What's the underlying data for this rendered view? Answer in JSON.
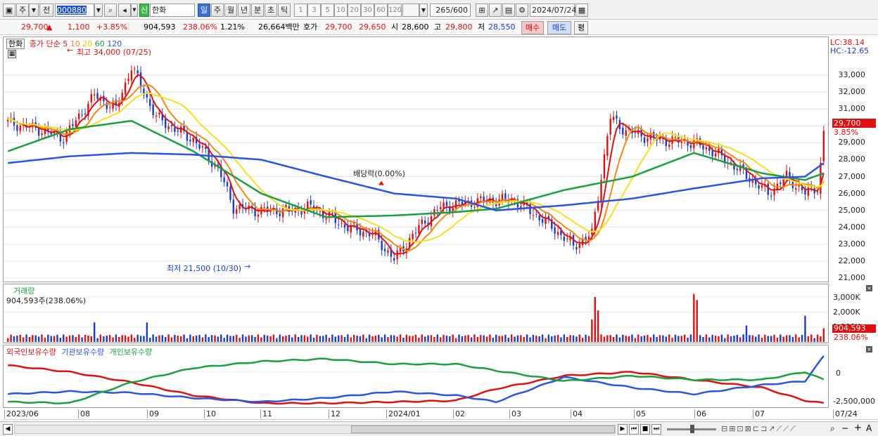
{
  "toolbar": {
    "type_label": "주",
    "jeon_label": "전",
    "code_value": "000880",
    "sin_label": "신",
    "stock_name": "한화",
    "periods": [
      "일",
      "주",
      "월",
      "년",
      "분",
      "초",
      "틱"
    ],
    "numbers": [
      "1",
      "3",
      "5",
      "10",
      "20",
      "30",
      "60",
      "120"
    ],
    "count": "265",
    "count_total": "/600",
    "date": "2024/07/24"
  },
  "price": {
    "current": "29,700",
    "arrow": "▲",
    "change": "1,100",
    "change_pct": "+3.85%",
    "volume": "904,593",
    "volume_ratio": "238.06%",
    "turnover": "1.21%",
    "amount": "26,664백만",
    "hoga_label": "호가",
    "ask": "29,700",
    "bid": "29,650",
    "open_label": "시",
    "open": "28,600",
    "high_label": "고",
    "high": "29,800",
    "low_label": "저",
    "low": "28,550",
    "buy_label": "매수",
    "sell_label": "매도",
    "eval_label": "평"
  },
  "legend": {
    "stock": "한화",
    "ma_title": "종가 단순",
    "ma_periods": [
      "5",
      "10",
      "20",
      "60",
      "120"
    ]
  },
  "annotations": {
    "high": "최고 34,000 (07/25)",
    "low": "최저 21,500 (10/30)",
    "dividend": "배당락(0.00%)",
    "lc": "LC:38.14",
    "hc": "HC:-12.65",
    "last_price": "29,700",
    "last_pct": "3.85%",
    "last_volume": "904,593",
    "last_volume_pct": "238.06%"
  },
  "volume_pane": {
    "title": "거래량",
    "value": "904,593주(238.06%)"
  },
  "holdings_pane": {
    "series_labels": [
      "외국인보유수량",
      "기관보유수량",
      "개인보유수량"
    ]
  },
  "price_ticks": [
    "33,000",
    "32,000",
    "31,000",
    "30,000",
    "29,000",
    "28,000",
    "27,000",
    "26,000",
    "25,000",
    "24,000",
    "23,000",
    "22,000",
    "21,000"
  ],
  "volume_ticks": [
    "3,000K",
    "2,000K",
    "1,000K"
  ],
  "holdings_ticks": [
    "0",
    "-2,500,000"
  ],
  "date_ticks": [
    "2023/06",
    "08",
    "09",
    "10",
    "11",
    "12",
    "2024/01",
    "02",
    "03",
    "04",
    "05",
    "06",
    "07",
    "07/24"
  ],
  "colors": {
    "up": "#e01010",
    "down": "#1a3ccc",
    "ma5": "#e01010",
    "ma10": "#f08a10",
    "ma20": "#f5e020",
    "ma60": "#1aa040",
    "ma120": "#2a55e0",
    "foreign": "#e01010",
    "institution": "#2a55e0",
    "individual": "#1aa040"
  },
  "chart_data": {
    "type": "line",
    "x": [
      "2023/06",
      "07",
      "08",
      "09",
      "10",
      "11",
      "12",
      "2024/01",
      "02",
      "03",
      "04",
      "05",
      "06",
      "07",
      "07/24"
    ],
    "series": [
      {
        "name": "종가",
        "values": [
          30000,
          31000,
          29000,
          25000,
          24000,
          22000,
          25500,
          25500,
          23000,
          30000,
          29000,
          26500,
          26500,
          27500,
          29700
        ]
      },
      {
        "name": "120",
        "values": [
          27800,
          28200,
          28400,
          28300,
          28000,
          27000,
          26000,
          25700,
          25000,
          25300,
          25700,
          26300,
          26900,
          27000,
          27800
        ]
      },
      {
        "name": "60",
        "values": [
          28500,
          29800,
          30300,
          28500,
          26000,
          24600,
          24700,
          24900,
          25100,
          26200,
          27000,
          28400,
          27200,
          26800,
          27200
        ]
      },
      {
        "name": "외국인보유수량",
        "values": [
          500000,
          0,
          -800000,
          -1800000,
          -2400000,
          -2400000,
          -2300000,
          -2200000,
          -1300000,
          -300000,
          0,
          -600000,
          -1200000,
          -2200000,
          -2400000
        ]
      },
      {
        "name": "기관보유수량",
        "values": [
          -1700000,
          -1500000,
          -1600000,
          -2000000,
          -2300000,
          -2000000,
          -1500000,
          -1800000,
          -2300000,
          -400000,
          -1200000,
          -1700000,
          -1000000,
          -700000,
          1200000
        ]
      },
      {
        "name": "개인보유수량",
        "values": [
          -2300000,
          -2400000,
          -800000,
          300000,
          800000,
          1000000,
          600000,
          600000,
          100000,
          -700000,
          -300000,
          -600000,
          -600000,
          0,
          -600000
        ]
      }
    ],
    "ylim": [
      21000,
      34000
    ]
  }
}
